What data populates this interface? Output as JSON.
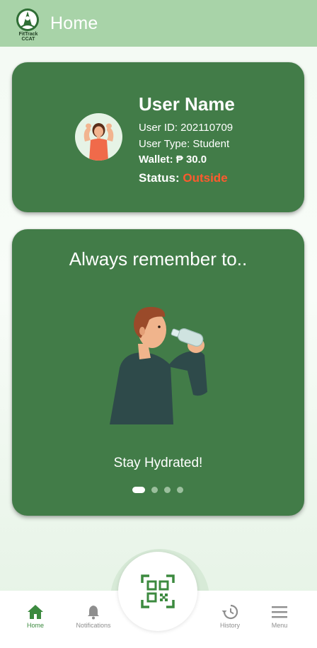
{
  "header": {
    "title": "Home",
    "logo_text_top": "FitTrack",
    "logo_text_bottom": "CCAT"
  },
  "profile": {
    "name": "User Name",
    "user_id_label": "User ID: 202110709",
    "user_type_label": "User Type: Student",
    "wallet_label": "Wallet: ₱ 30.0",
    "status_label": "Status:",
    "status_value": "Outside",
    "avatar_icon": "flexing-woman-avatar"
  },
  "reminder": {
    "title": "Always remember to..",
    "caption": "Stay Hydrated!",
    "illustration": "man-drinking-water",
    "slide_index": 1,
    "slide_count": 4
  },
  "nav": {
    "items": [
      {
        "label": "Home",
        "icon": "home-icon",
        "active": true
      },
      {
        "label": "Notifications",
        "icon": "bell-icon",
        "active": false
      },
      {
        "label": "History",
        "icon": "history-icon",
        "active": false
      },
      {
        "label": "Menu",
        "icon": "menu-icon",
        "active": false
      }
    ],
    "center_button_icon": "qr-scan-icon"
  },
  "colors": {
    "header_bg": "#a8d3a8",
    "card_bg": "#427c48",
    "status_outside": "#ff5a2e",
    "nav_active": "#3c8a3f",
    "nav_inactive": "#8e8e8e"
  }
}
